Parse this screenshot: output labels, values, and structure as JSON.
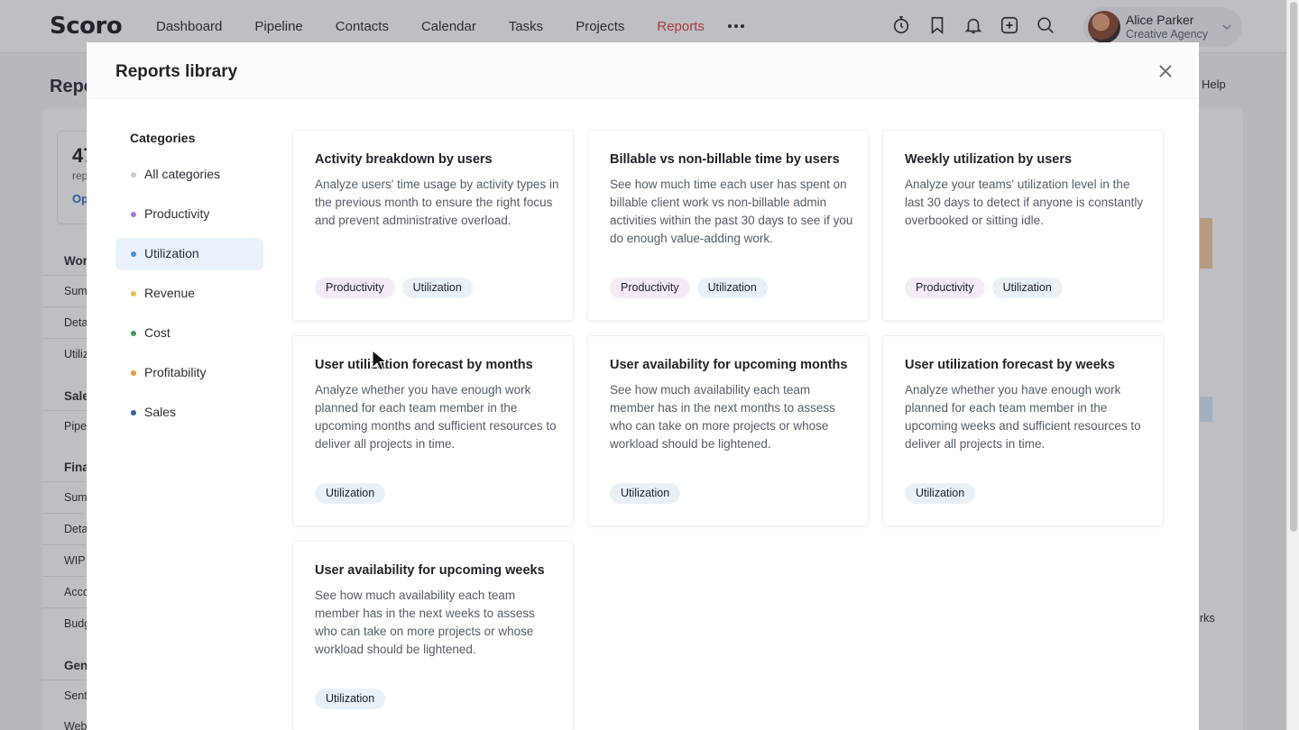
{
  "app": {
    "logo_text": "Scoro",
    "nav": [
      "Dashboard",
      "Pipeline",
      "Contacts",
      "Calendar",
      "Tasks",
      "Projects",
      "Reports"
    ],
    "active_nav": "Reports",
    "user": {
      "name": "Alice Parker",
      "org": "Creative Agency"
    }
  },
  "background": {
    "title": "Repo",
    "help": "Help",
    "card_num": "47",
    "card_sub": "rep",
    "card_link": "Op",
    "sections": [
      {
        "head": "Wor",
        "items": [
          "Sum",
          "Deta",
          "Utiliz"
        ]
      },
      {
        "head": "Sale",
        "items": [
          "Pipe"
        ]
      },
      {
        "head": "Fina",
        "items": [
          "Sum",
          "Deta",
          "WIP",
          "Acco",
          "Budg"
        ]
      },
      {
        "head": "Gen",
        "items": [
          "Sent",
          "Web"
        ]
      }
    ],
    "right_text": "rks"
  },
  "modal": {
    "title": "Reports library",
    "categories_heading": "Categories",
    "categories": [
      {
        "label": "All categories",
        "color": "#c9ccd1"
      },
      {
        "label": "Productivity",
        "color": "#a27ad6"
      },
      {
        "label": "Utilization",
        "color": "#4b8fd8"
      },
      {
        "label": "Revenue",
        "color": "#e7c04a"
      },
      {
        "label": "Cost",
        "color": "#3f9a62"
      },
      {
        "label": "Profitability",
        "color": "#ee9a3e"
      },
      {
        "label": "Sales",
        "color": "#3d5a9a"
      }
    ],
    "active_category": "Utilization",
    "reports": [
      {
        "title": "Activity breakdown by users",
        "description": "Analyze users' time usage by activity types in the previous month to ensure the right focus and prevent administrative overload.",
        "tags": [
          "Productivity",
          "Utilization"
        ]
      },
      {
        "title": "Billable vs non-billable time by users",
        "description": "See how much time each user has spent on billable client work vs non-billable admin activities within the past 30 days to see if you do enough value-adding work.",
        "tags": [
          "Productivity",
          "Utilization"
        ]
      },
      {
        "title": "Weekly utilization by users",
        "description": "Analyze your teams' utilization level in the last 30 days to detect if anyone is constantly overbooked or sitting idle.",
        "tags": [
          "Productivity",
          "Utilization"
        ]
      },
      {
        "title": "User utilization forecast by months",
        "description": "Analyze whether you have enough work planned for each team member in the upcoming months and sufficient resources to deliver all projects in time.",
        "tags": [
          "Utilization"
        ]
      },
      {
        "title": "User availability for upcoming months",
        "description": "See how much availability each team member has in the next months to assess who can take on more projects or whose workload should be lightened.",
        "tags": [
          "Utilization"
        ]
      },
      {
        "title": "User utilization forecast by weeks",
        "description": "Analyze whether you have enough work planned for each team member in the upcoming weeks and sufficient resources to deliver all projects in time.",
        "tags": [
          "Utilization"
        ]
      },
      {
        "title": "User availability for upcoming weeks",
        "description": "See how much availability each team member has in the next weeks to assess who can take on more projects or whose workload should be lightened.",
        "tags": [
          "Utilization"
        ]
      }
    ]
  }
}
